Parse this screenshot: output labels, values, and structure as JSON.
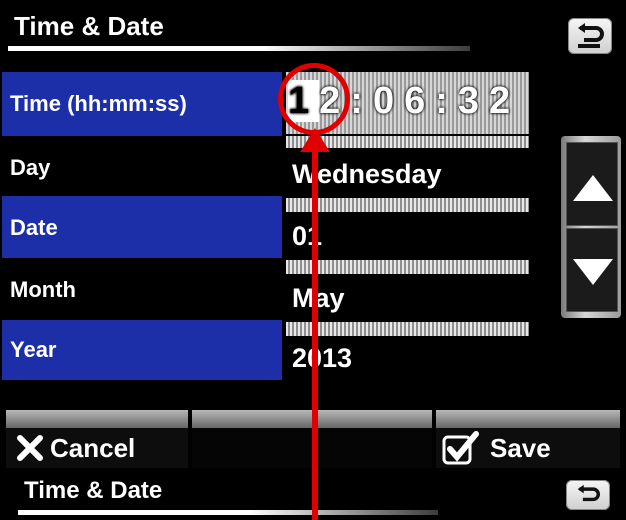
{
  "header": {
    "title": "Time & Date",
    "back_icon": "back-arrow-icon"
  },
  "rows": [
    {
      "label": "Time (hh:mm:ss)",
      "highlight": true
    },
    {
      "label": "Day",
      "value": "Wednesday",
      "highlight": false
    },
    {
      "label": "Date",
      "value": "01",
      "highlight": true
    },
    {
      "label": "Month",
      "value": "May",
      "highlight": false
    },
    {
      "label": "Year",
      "value": "2013",
      "highlight": true
    }
  ],
  "time": {
    "hh_first": "1",
    "hh_second": "2",
    "sep1": ":",
    "mm": "06",
    "sep2": ":",
    "ss": "32"
  },
  "scroll": {
    "up_icon": "triangle-up-icon",
    "down_icon": "triangle-down-icon"
  },
  "buttons": {
    "cancel": "Cancel",
    "save": "Save"
  },
  "footer": {
    "title": "Time & Date"
  },
  "colors": {
    "row_blue": "#1d2fa8",
    "annotation_red": "#e00000"
  }
}
